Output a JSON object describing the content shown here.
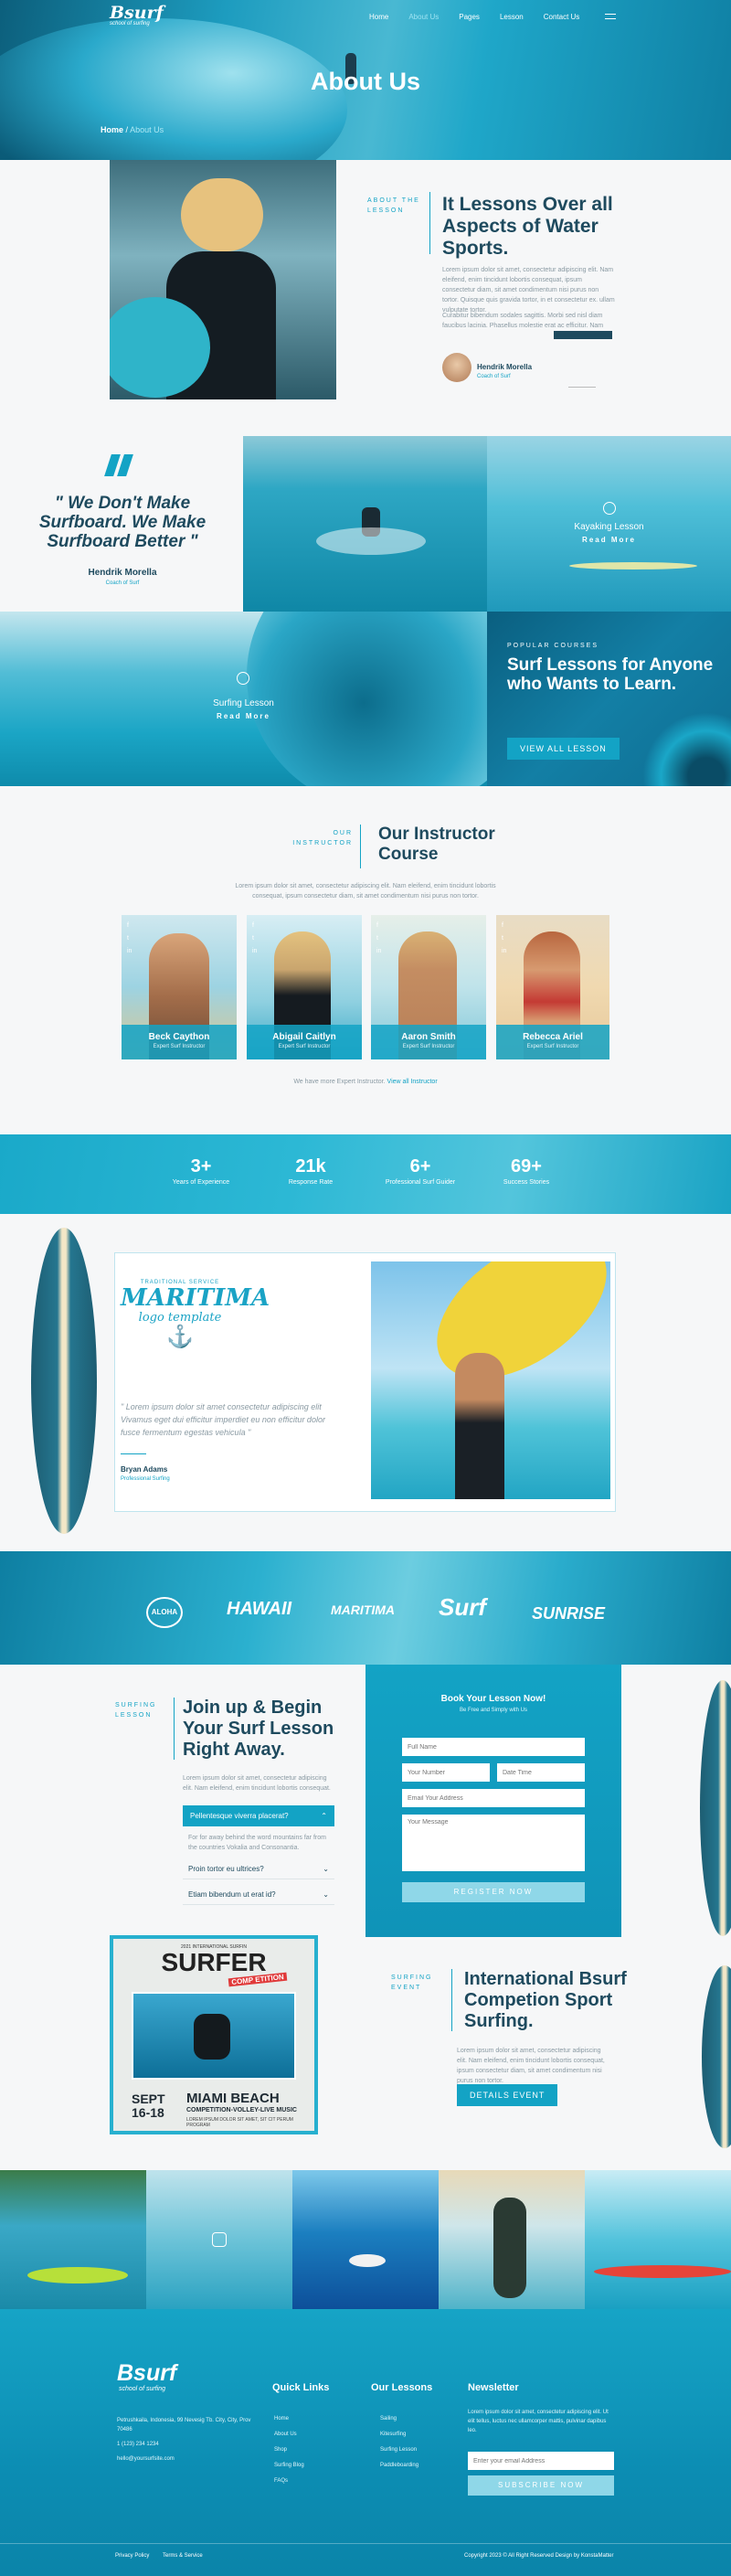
{
  "brand": {
    "name": "Bsurf",
    "tagline": "school of surfing"
  },
  "nav": {
    "items": [
      "Home",
      "About Us",
      "Pages",
      "Lesson",
      "Contact Us"
    ],
    "active": 1
  },
  "hero": {
    "title": "About Us",
    "crumb_home": "Home",
    "crumb_sep": "/",
    "crumb_current": "About Us"
  },
  "about": {
    "tag": "ABOUT THE LESSON",
    "title": "It Lessons Over all Aspects of Water Sports.",
    "p1": "Lorem ipsum dolor sit amet, consectetur adipiscing elit. Nam eleifend, enim tincidunt lobortis consequat, ipsum consectetur diam, sit amet condimentum nisi purus non tortor. Quisque quis gravida tortor, in et consectetur ex. ullam vulputate tortor.",
    "p2": "Curabitur bibendum sodales sagittis. Morbi sed nisl diam faucibus lacinia. Phasellus molestie erat ac efficitur. Nam semper quam in. Cras efficitur sed lorem.",
    "author": "Hendrik Morella",
    "role": "Coach of Surf"
  },
  "quote": {
    "mark": "\"",
    "text": "\" We Don't Make Surfboard. We Make Surfboard Better \"",
    "author": "Hendrik Morella",
    "role": "Coach of Surf"
  },
  "tiles": [
    {
      "title": "Kayaking Lesson",
      "more": "Read More"
    },
    {
      "title": "Surfing Lesson",
      "more": "Read More"
    }
  ],
  "popular": {
    "tag": "POPULAR COURSES",
    "title": "Surf Lessons for Anyone who Wants to Learn.",
    "button": "VIEW ALL LESSON"
  },
  "instructor": {
    "tag": "OUR INSTRUCTOR",
    "title": "Our Instructor Course",
    "desc": "Lorem ipsum dolor sit amet, consectetur adipiscing elit. Nam eleifend, enim tincidunt lobortis consequat, ipsum consectetur diam, sit amet condimentum nisi purus non tortor.",
    "footer_text": "We have more Expert Instructor.",
    "footer_link": "View all Instructor",
    "people": [
      {
        "name": "Beck Caython",
        "role": "Expert Surf Instructor"
      },
      {
        "name": "Abigail Caitlyn",
        "role": "Expert Surf Instructor"
      },
      {
        "name": "Aaron Smith",
        "role": "Expert Surf Instructor"
      },
      {
        "name": "Rebecca Ariel",
        "role": "Expert Surf Instructor"
      }
    ],
    "social": [
      "f",
      "t",
      "in"
    ]
  },
  "stats": [
    {
      "value": "3+",
      "label": "Years of Experience"
    },
    {
      "value": "21k",
      "label": "Response Rate"
    },
    {
      "value": "6+",
      "label": "Professional Surf Guider"
    },
    {
      "value": "69+",
      "label": "Success Stories"
    }
  ],
  "testimonial": {
    "logo_top": "TRADITIONAL SERVICE",
    "logo_main": "MARITIMA",
    "logo_sub": "logo template",
    "quote": "\" Lorem ipsum dolor sit amet consectetur adipiscing elit Vivamus eget dui efficitur imperdiet eu non efficitur dolor fusce fermentum egestas vehicula \"",
    "author": "Bryan Adams",
    "role": "Professional Surfing"
  },
  "brands": [
    "ALOHA",
    "HAWAII",
    "MARITIMA",
    "Surf",
    "SUNRISE"
  ],
  "join": {
    "tag": "SURFING LESSON",
    "title": "Join up & Begin Your Surf Lesson Right Away.",
    "desc": "Lorem ipsum dolor sit amet, consectetur adipiscing elit. Nam eleifend, enim tincidunt lobortis consequat.",
    "acc1": "Pellentesque viverra placerat?",
    "acc1_body": "For for away behind the word mountains far from the countries Vokalia and Consonantia.",
    "acc2": "Proin tortor eu ultrices?",
    "acc3": "Etiam bibendum ut erat id?"
  },
  "booking": {
    "title": "Book Your Lesson Now!",
    "sub": "Be Free and Simply with Us",
    "name_ph": "Full Name",
    "phone_ph": "Your Number",
    "date_ph": "Date Time",
    "email_ph": "Email Your Address",
    "msg_ph": "Your Message",
    "button": "REGISTER NOW"
  },
  "event": {
    "tag": "SURFING EVENT",
    "title": "International Bsurf Competion Sport Surfing.",
    "desc": "Lorem ipsum dolor sit amet, consectetur adipiscing elit. Nam eleifend, enim tincidunt lobortis consequat, ipsum consectetur diam, sit amet condimentum nisi purus non tortor.",
    "button": "DETAILS EVENT",
    "poster_top": "2021 INTERNATIONAL SURFIN",
    "poster_title": "SURFER",
    "poster_comp": "COMP ETITION",
    "poster_date": "SEPT 16-18",
    "poster_place": "MIAMI BEACH",
    "poster_line1": "COMPETITION-VOLLEY-LIVE MUSIC",
    "poster_line2": "LOREM IPSUM DOLOR SIT AMET, SIT CIT PERUM PROGRAM"
  },
  "footer": {
    "address": "Petrushkaila, Indonesia, 99 Nevesig Tb. City, City, Prov 70486",
    "phone": "1 (123) 234 1234",
    "email": "hello@yoursurfsite.com",
    "quick_title": "Quick Links",
    "quick": [
      "Home",
      "About Us",
      "Shop",
      "Surfing Blog",
      "FAQs"
    ],
    "lessons_title": "Our Lessons",
    "lessons": [
      "Sailing",
      "Kitesurfing",
      "Surfing Lesson",
      "Paddleboarding"
    ],
    "news_title": "Newsletter",
    "news_desc": "Lorem ipsum dolor sit amet, consectetur adipiscing elit. Ut elit tellus, luctus nec ullamcorper mattis, pulvinar dapibus leo.",
    "news_ph": "Enter your email Address",
    "news_button": "SUBSCRIBE NOW",
    "bottom_left1": "Privacy Policy",
    "bottom_left2": "Terms & Service",
    "copyright": "Copyright 2023 © All Right Reserved Design by KonstaMatter"
  },
  "colors": {
    "primary": "#13a3c5",
    "navy": "#1e4a5e",
    "footer": "#0a8fb5"
  }
}
